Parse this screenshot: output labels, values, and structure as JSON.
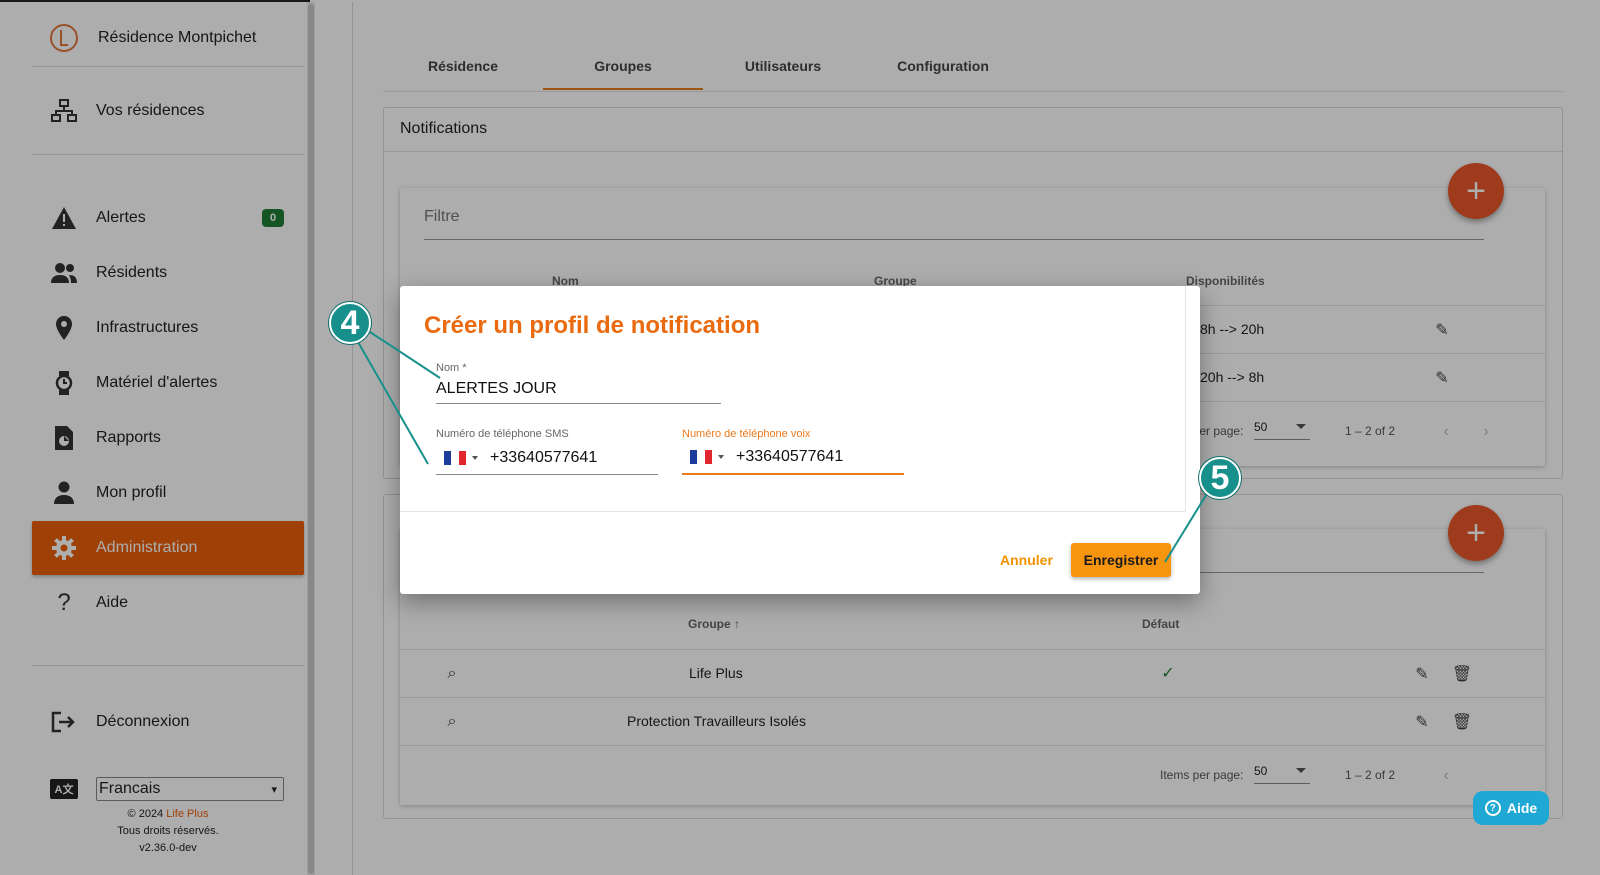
{
  "sidebar": {
    "residence_name": "Résidence Montpichet",
    "your_residences": "Vos résidences",
    "items": [
      {
        "label": "Alertes",
        "badge": "0"
      },
      {
        "label": "Résidents"
      },
      {
        "label": "Infrastructures"
      },
      {
        "label": "Matériel d'alertes"
      },
      {
        "label": "Rapports"
      },
      {
        "label": "Mon profil"
      },
      {
        "label": "Administration"
      },
      {
        "label": "Aide"
      }
    ],
    "logout": "Déconnexion",
    "language": "Francais",
    "footer": {
      "copyright": "© 2024",
      "brand": "Life Plus",
      "rights": "Tous droits réservés.",
      "version": "v2.36.0-dev"
    }
  },
  "tabs": [
    "Résidence",
    "Groupes",
    "Utilisateurs",
    "Configuration"
  ],
  "notifications": {
    "title": "Notifications",
    "filter_placeholder": "Filtre",
    "columns": {
      "name": "Nom",
      "group": "Groupe",
      "availability": "Disponibilités"
    },
    "rows": [
      {
        "availability": "8h --> 20h"
      },
      {
        "availability": "20h --> 8h"
      }
    ],
    "pager": {
      "items_per_page": "Items per page:",
      "per_page_value": "50",
      "range": "1 – 2 of 2"
    }
  },
  "groups": {
    "columns": {
      "group": "Groupe",
      "default": "Défaut"
    },
    "rows": [
      {
        "name": "Life Plus",
        "default": true
      },
      {
        "name": "Protection Travailleurs Isolés",
        "default": false
      }
    ],
    "pager": {
      "items_per_page": "Items per page:",
      "per_page_value": "50",
      "range": "1 – 2 of 2"
    }
  },
  "dialog": {
    "title": "Créer un profil de notification",
    "name_label": "Nom *",
    "name_value": "ALERTES JOUR",
    "sms_label": "Numéro de téléphone SMS",
    "sms_value": "+33640577641",
    "voice_label": "Numéro de téléphone voix",
    "voice_value": "+33640577641",
    "cancel": "Annuler",
    "save": "Enregistrer"
  },
  "callouts": [
    "4",
    "5"
  ],
  "help_button": "Aide",
  "colors": {
    "accent": "#ea5f0b",
    "primary_button": "#f7950f",
    "callout": "#17908c",
    "help": "#1ea8d3",
    "badge": "#1e7e34"
  }
}
